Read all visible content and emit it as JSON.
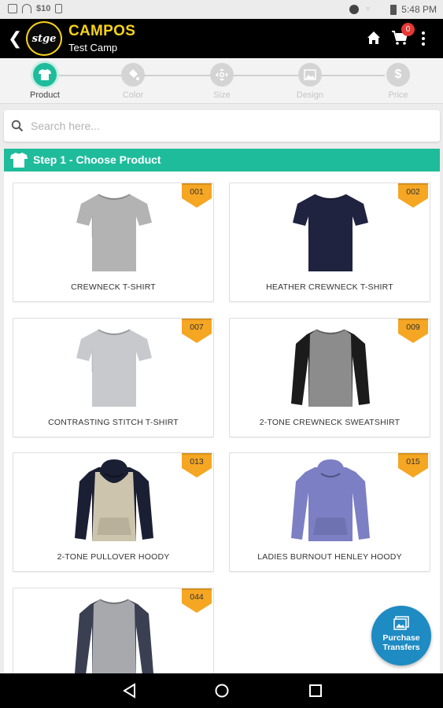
{
  "status_bar": {
    "carrier_text": "$10",
    "battery_percent": "71",
    "time": "5:48 PM"
  },
  "header": {
    "logo_text": "stge",
    "camp_name": "CAMPOS",
    "camp_subtitle": "Test Camp",
    "cart_count": "0"
  },
  "stepper": {
    "steps": [
      {
        "label": "Product",
        "icon": "tshirt-icon",
        "active": true
      },
      {
        "label": "Color",
        "icon": "paint-bucket-icon",
        "active": false
      },
      {
        "label": "Size",
        "icon": "resize-icon",
        "active": false
      },
      {
        "label": "Design",
        "icon": "image-icon",
        "active": false
      },
      {
        "label": "Price",
        "icon": "dollar-icon",
        "active": false
      }
    ]
  },
  "search": {
    "placeholder": "Search here..."
  },
  "panel": {
    "title": "Step 1 - Choose Product"
  },
  "products": [
    {
      "code": "001",
      "name": "CREWNECK T-SHIRT",
      "garment": "tee",
      "body_color": "#b3b3b3",
      "sleeve_color": "#b3b3b3"
    },
    {
      "code": "002",
      "name": "HEATHER CREWNECK T-SHIRT",
      "garment": "tee",
      "body_color": "#1f2340",
      "sleeve_color": "#1f2340"
    },
    {
      "code": "007",
      "name": "CONTRASTING STITCH T-SHIRT",
      "garment": "tee",
      "body_color": "#c7c9cc",
      "sleeve_color": "#c7c9cc"
    },
    {
      "code": "009",
      "name": "2-TONE CREWNECK SWEATSHIRT",
      "garment": "sweatshirt",
      "body_color": "#8c8c8c",
      "sleeve_color": "#1b1b1b"
    },
    {
      "code": "013",
      "name": "2-TONE PULLOVER HOODY",
      "garment": "hoody",
      "body_color": "#cdc4ad",
      "sleeve_color": "#1a1f33"
    },
    {
      "code": "015",
      "name": "LADIES BURNOUT HENLEY HOODY",
      "garment": "hoody",
      "body_color": "#7c7fc4",
      "sleeve_color": "#7c7fc4"
    },
    {
      "code": "044",
      "name": "",
      "garment": "sweatshirt",
      "body_color": "#a7a9ad",
      "sleeve_color": "#3a3f52"
    }
  ],
  "fab": {
    "label_line1": "Purchase",
    "label_line2": "Transfers"
  },
  "colors": {
    "accent": "#1fbc9c",
    "brand_yellow": "#f6d21c",
    "tag_orange": "#f5a623",
    "fab_blue": "#1e8bc3",
    "badge_red": "#e53935"
  }
}
